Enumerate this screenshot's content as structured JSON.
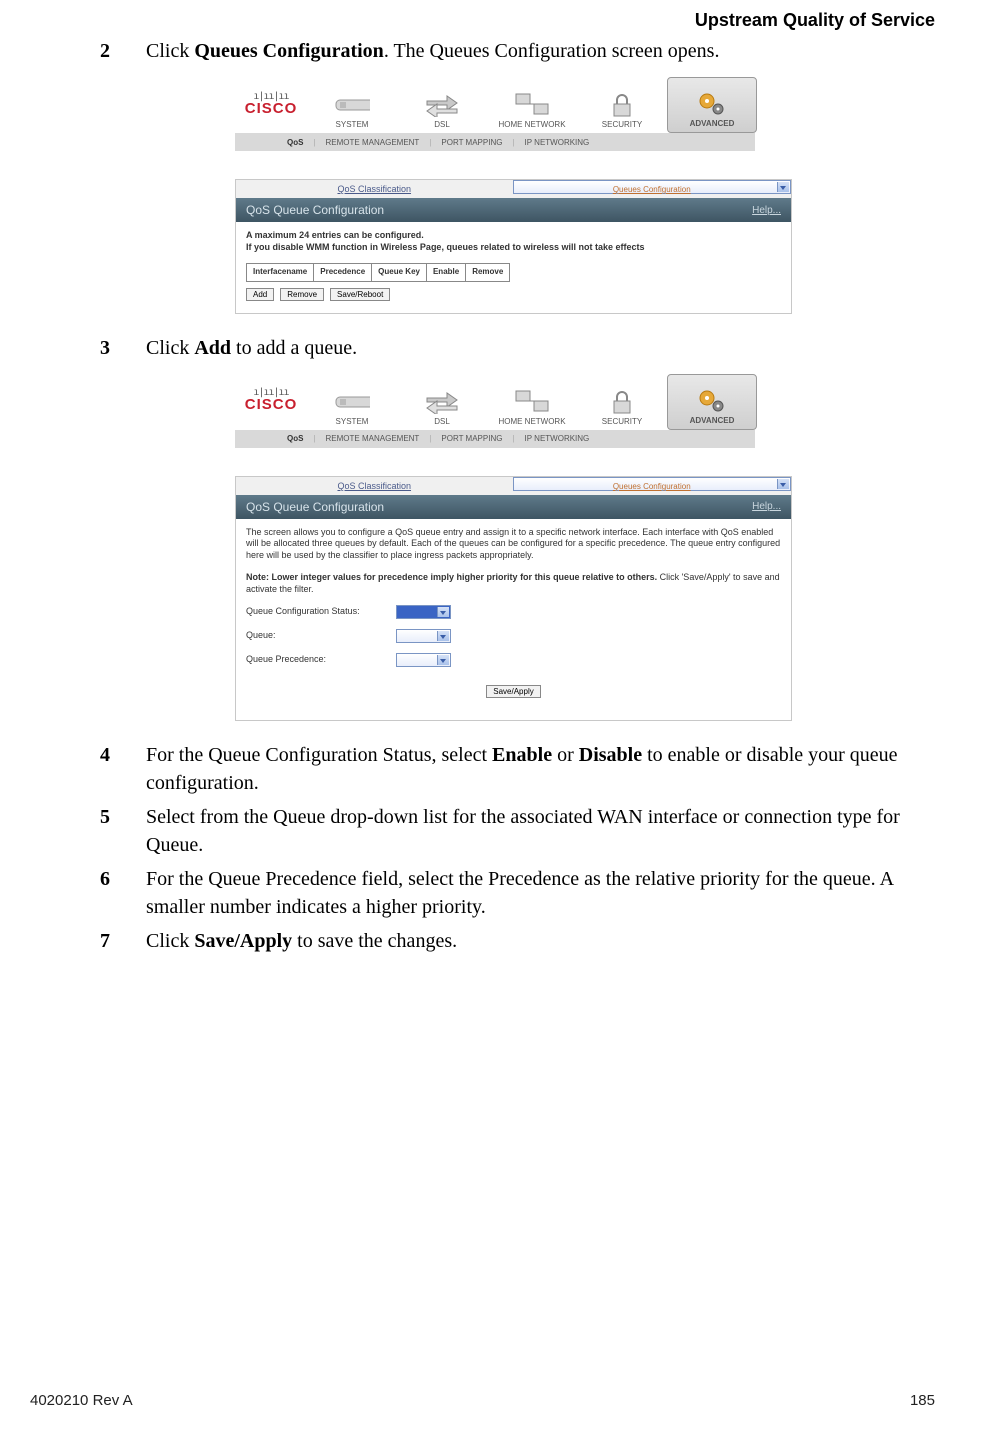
{
  "header": {
    "section_title": "Upstream Quality of Service"
  },
  "steps": {
    "s2": {
      "num": "2",
      "pre": "Click ",
      "bold": "Queues Configuration",
      "post": ". The Queues Configuration screen opens."
    },
    "s3": {
      "num": "3",
      "pre": "Click ",
      "bold": "Add",
      "post": " to add a queue."
    },
    "s4": {
      "num": "4",
      "pre": "For the Queue Configuration Status, select ",
      "bold1": "Enable",
      "mid": " or ",
      "bold2": "Disable",
      "post": " to enable or disable your queue configuration."
    },
    "s5": {
      "num": "5",
      "text": "Select from the Queue drop-down list for the associated WAN interface or connection type for Queue."
    },
    "s6": {
      "num": "6",
      "text": "For the Queue Precedence field, select the Precedence as the relative priority for the queue.  A smaller number indicates a higher priority."
    },
    "s7": {
      "num": "7",
      "pre": "Click ",
      "bold": "Save/Apply",
      "post": " to save the changes."
    }
  },
  "shot_common": {
    "cisco": "CISCO",
    "topnav": [
      "SYSTEM",
      "DSL",
      "HOME NETWORK",
      "SECURITY",
      "ADVANCED"
    ],
    "subnav": [
      "QoS",
      "REMOTE MANAGEMENT",
      "PORT MAPPING",
      "IP NETWORKING"
    ],
    "panel_tabs": [
      "QoS Classification",
      "Queues Configuration"
    ],
    "help": "Help..."
  },
  "shot1": {
    "panel_title": "QoS Queue Configuration",
    "line1": "A maximum 24 entries can be configured.",
    "line2": "If you disable WMM function in Wireless Page, queues related to wireless will not take effects",
    "columns": [
      "Interfacename",
      "Precedence",
      "Queue Key",
      "Enable",
      "Remove"
    ],
    "buttons": [
      "Add",
      "Remove",
      "Save/Reboot"
    ]
  },
  "shot2": {
    "panel_title": "QoS Queue Configuration",
    "desc": "The screen allows you to configure a QoS queue entry and assign it to a specific network interface. Each interface with QoS enabled will be allocated three queues by default. Each of the queues can be configured for a specific precedence. The queue entry configured here will be used by the classifier to place ingress packets appropriately.",
    "note_bold": "Note: Lower integer values for precedence imply higher priority for this queue relative to others.",
    "note_rest": " Click 'Save/Apply' to save and activate the filter.",
    "fields": {
      "status": "Queue Configuration Status:",
      "queue": "Queue:",
      "precedence": "Queue Precedence:"
    },
    "save_apply": "Save/Apply"
  },
  "footer": {
    "left": "4020210 Rev A",
    "right": "185"
  }
}
